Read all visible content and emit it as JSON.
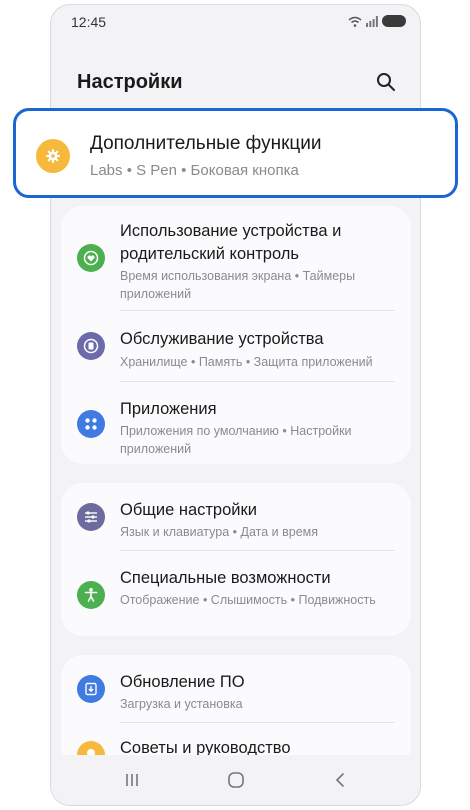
{
  "status": {
    "time": "12:45"
  },
  "header": {
    "title": "Настройки"
  },
  "highlighted": {
    "title": "Дополнительные функции",
    "subtitle": "Labs • S Pen • Боковая кнопка",
    "icon": "gear-icon",
    "color": "#f6b93b"
  },
  "groups": [
    {
      "items": [
        {
          "title": "Использование устройства и родительский контроль",
          "subtitle": "Время использования экрана • Таймеры приложений",
          "icon": "heart-icon",
          "color": "#4caf50"
        },
        {
          "title": "Обслуживание устройства",
          "subtitle": "Хранилище • Память • Защита приложений",
          "icon": "device-care-icon",
          "color": "#6b6baa"
        },
        {
          "title": "Приложения",
          "subtitle": "Приложения по умолчанию • Настройки приложений",
          "icon": "apps-icon",
          "color": "#3f7be0"
        }
      ]
    },
    {
      "items": [
        {
          "title": "Общие настройки",
          "subtitle": "Язык и клавиатура • Дата и время",
          "icon": "sliders-icon",
          "color": "#6b6b9e"
        },
        {
          "title": "Специальные возможности",
          "subtitle": "Отображение • Слышимость • Подвижность",
          "icon": "accessibility-icon",
          "color": "#4caf50"
        }
      ]
    },
    {
      "items": [
        {
          "title": "Обновление ПО",
          "subtitle": "Загрузка и установка",
          "icon": "software-update-icon",
          "color": "#3f7be0"
        },
        {
          "title": "Советы и руководство",
          "subtitle": "",
          "icon": "lightbulb-icon",
          "color": "#f6b93b"
        }
      ]
    }
  ]
}
